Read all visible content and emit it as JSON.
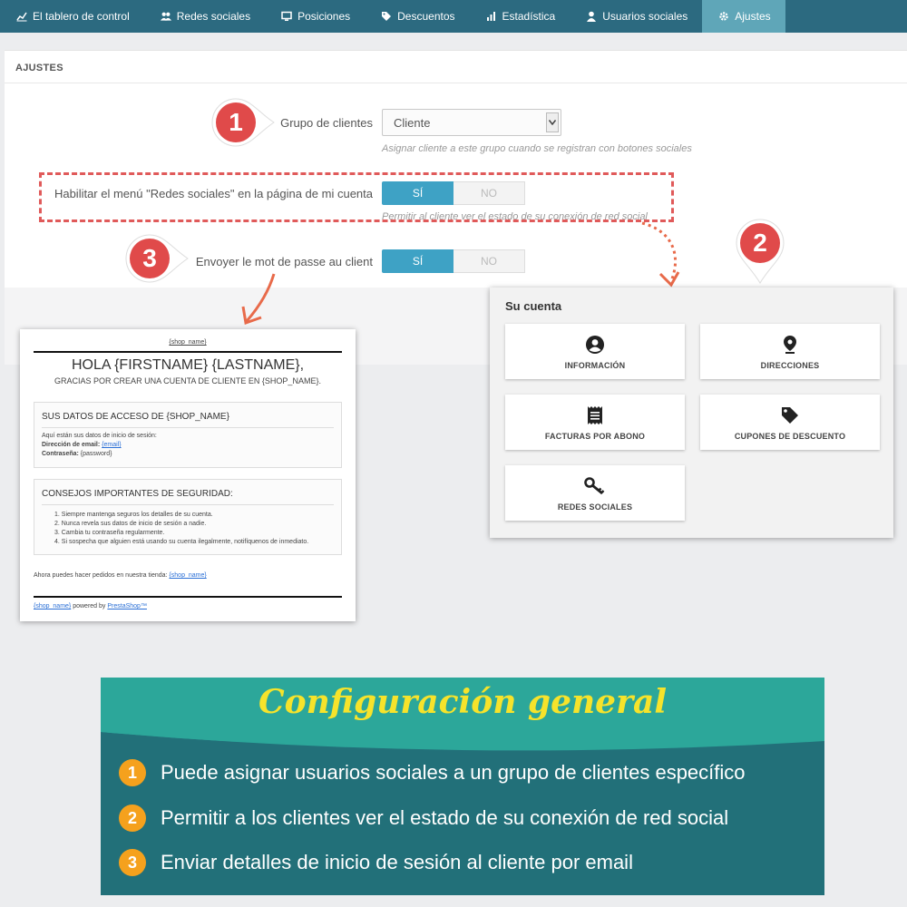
{
  "nav": {
    "items": [
      {
        "label": "El tablero de control",
        "icon": "chart-line-icon"
      },
      {
        "label": "Redes sociales",
        "icon": "users-icon"
      },
      {
        "label": "Posiciones",
        "icon": "monitor-icon"
      },
      {
        "label": "Descuentos",
        "icon": "tag-icon"
      },
      {
        "label": "Estadística",
        "icon": "bar-chart-icon"
      },
      {
        "label": "Usuarios sociales",
        "icon": "user-icon"
      },
      {
        "label": "Ajustes",
        "icon": "gear-icon"
      }
    ],
    "active_index": 6
  },
  "settings": {
    "title": "AJUSTES",
    "group_label": "Grupo de clientes",
    "group_value": "Cliente",
    "group_help": "Asignar cliente a este grupo cuando se registran con botones sociales",
    "menu_label": "Habilitar el menú \"Redes sociales\" en la página de mi cuenta",
    "menu_help": "Permitir al cliente ver el estado de su conexión de red social",
    "password_label": "Envoyer le mot de passe au client",
    "toggle_yes": "SÍ",
    "toggle_no": "NO"
  },
  "badges": {
    "one": "1",
    "two": "2",
    "three": "3"
  },
  "account": {
    "title": "Su cuenta",
    "tiles": [
      {
        "label": "INFORMACIÓN",
        "icon": "user-circle-icon"
      },
      {
        "label": "DIRECCIONES",
        "icon": "map-pin-icon"
      },
      {
        "label": "FACTURAS POR ABONO",
        "icon": "receipt-icon"
      },
      {
        "label": "CUPONES DE DESCUENTO",
        "icon": "tag-icon"
      },
      {
        "label": "REDES SOCIALES",
        "icon": "key-icon"
      }
    ]
  },
  "email": {
    "shop_link": "{shop_name}",
    "greeting": "HOLA {FIRSTNAME} {LASTNAME},",
    "subtitle": "GRACIAS POR CREAR UNA CUENTA DE CLIENTE EN {SHOP_NAME}.",
    "box1_title": "SUS DATOS DE ACCESO DE {SHOP_NAME}",
    "box1_intro": "Aquí están sus datos de inicio de sesión:",
    "email_label": "Dirección de email:",
    "email_value": "{email}",
    "password_label": "Contraseña:",
    "password_value": "{password}",
    "box2_title": "CONSEJOS IMPORTANTES DE SEGURIDAD:",
    "tips": [
      "1. Siempre mantenga seguros los detalles de su cuenta.",
      "2. Nunca revela sus datos de inicio de sesión a nadie.",
      "3. Cambia tu contraseña regularmente.",
      "4. Si sospecha que alguien está usando su cuenta ilegalmente, notifíquenos de inmediato."
    ],
    "footer_text": "Ahora puedes hacer pedidos en nuestra tienda:",
    "footer_link": "{shop_name}",
    "powered_link": "{shop_name}",
    "powered_text": "powered by",
    "powered_brand": "PrestaShop™"
  },
  "banner": {
    "title": "Configuración general",
    "features": [
      {
        "num": "1",
        "text": "Puede asignar usuarios sociales a un grupo de clientes específico"
      },
      {
        "num": "2",
        "text": "Permitir a los clientes ver el estado de su conexión de red social"
      },
      {
        "num": "3",
        "text": "Enviar detalles de inicio de sesión al cliente por email"
      }
    ]
  },
  "colors": {
    "nav_bg": "#2c6a80",
    "nav_active": "#5fa6b8",
    "toggle_on": "#3ea2c5",
    "badge_red": "#e04a4a",
    "banner_top": "#2ca79a",
    "banner_bottom": "#227079",
    "banner_title": "#f6e32b",
    "feature_num": "#f5a11d"
  }
}
